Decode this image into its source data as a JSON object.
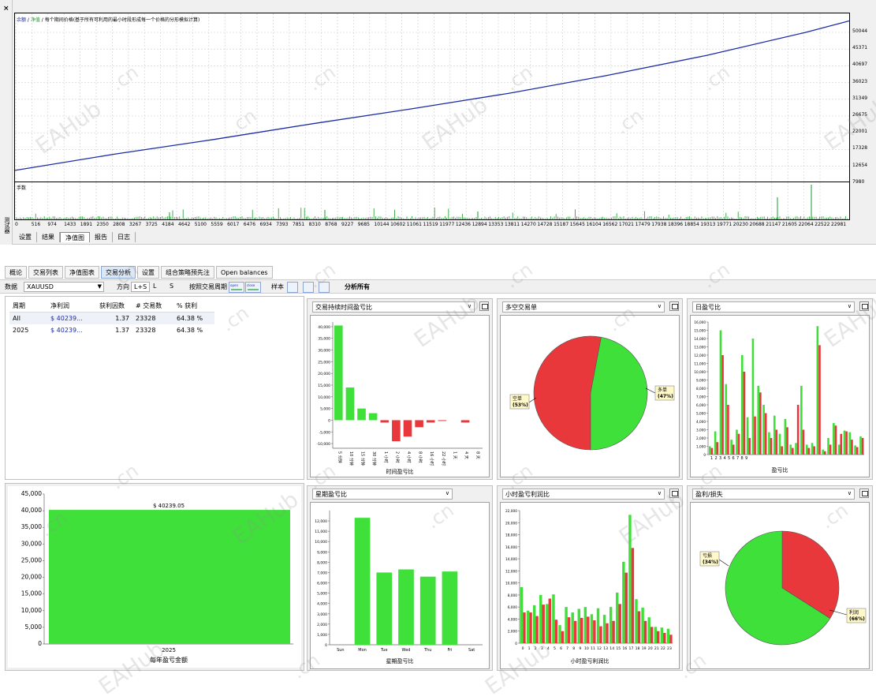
{
  "tester": {
    "close_label": "×",
    "side_label": "测试器",
    "graph_title_part1": "余额",
    "graph_title_sep1": " / ",
    "graph_title_part2": "净值",
    "graph_title_rest": " / 每个期间价格(基于所有可利用的最小时段形成每一个价格的分形模拟计算)",
    "vol_title": "手数",
    "y_ticks": [
      "50044",
      "45371",
      "40697",
      "36023",
      "31349",
      "26675",
      "22001",
      "17328",
      "12654",
      "7980"
    ],
    "x_ticks": [
      "0",
      "516",
      "974",
      "1433",
      "1891",
      "2350",
      "2808",
      "3267",
      "3725",
      "4184",
      "4642",
      "5100",
      "5559",
      "6017",
      "6476",
      "6934",
      "7393",
      "7851",
      "8310",
      "8768",
      "9227",
      "9685",
      "10144",
      "10602",
      "11061",
      "11519",
      "11977",
      "12436",
      "12894",
      "13353",
      "13811",
      "14270",
      "14728",
      "15187",
      "15645",
      "16104",
      "16562",
      "17021",
      "17479",
      "17938",
      "18396",
      "18854",
      "19313",
      "19771",
      "20230",
      "20688",
      "21147",
      "21605",
      "22064",
      "22522",
      "22981"
    ],
    "tabs": [
      "设置",
      "结果",
      "净值图",
      "报告",
      "日志"
    ],
    "active_tab": "净值图",
    "balance_color": "#1b2ca6",
    "equity_color": "#1b9a2a"
  },
  "analysis": {
    "tabs": [
      "概论",
      "交易列表",
      "净值图表",
      "交易分析",
      "设置",
      "组合策略预先注",
      "Open balances"
    ],
    "active_tab": "交易分析",
    "toolbar": {
      "data_label": "数据",
      "symbol": "XAUUSD",
      "direction_label": "方向",
      "dir_all": "L+S",
      "dir_long": "L",
      "dir_short": "S",
      "period_label": "按照交易周期",
      "open_time": "open time",
      "close_time": "close time",
      "sample_label": "样本",
      "analyze_all": "分析所有"
    },
    "stats_table": {
      "headers": [
        "周期",
        "净利润",
        "获利因数",
        "# 交易数",
        "% 获利"
      ],
      "rows": [
        [
          "All",
          "$ 40239...",
          "1.37",
          "23328",
          "64.38 %"
        ],
        [
          "2025",
          "$ 40239...",
          "1.37",
          "23328",
          "64.38 %"
        ]
      ]
    },
    "panels": {
      "hold_time": {
        "select": "交易持续时间盈亏比",
        "xlabel": "时间盈亏比"
      },
      "long_short": {
        "select": "多空交易单",
        "short_label": "空单",
        "short_pct": "(53%)",
        "long_label": "多单",
        "long_pct": "(47%)"
      },
      "daily": {
        "select": "日盈亏比",
        "xlabel": "盈亏比"
      },
      "yearly": {
        "xlabel": "每年盈亏金额",
        "value_label": "$ 40239.05"
      },
      "weekday": {
        "select": "星期盈亏比",
        "xlabel": "星期盈亏比"
      },
      "hourly": {
        "select": "小时盈亏利润比",
        "xlabel": "小时盈亏利润比"
      },
      "profit_loss": {
        "select": "盈利/损失",
        "loss_label": "亏损",
        "loss_pct": "(34%)",
        "profit_label": "利润",
        "profit_pct": "(66%)"
      }
    }
  },
  "watermark": {
    "text": "EAHub",
    "suffix": ".cn"
  },
  "chart_data": [
    {
      "type": "line",
      "title": "余额 / 净值",
      "ylim": [
        7980,
        52000
      ],
      "series": [
        {
          "name": "余额",
          "x": [
            0,
            2808,
            5559,
            8310,
            11061,
            13811,
            16562,
            19313,
            22064,
            23300
          ],
          "y": [
            10900,
            15200,
            19000,
            23100,
            27000,
            31100,
            35800,
            41000,
            47000,
            50044
          ]
        }
      ]
    },
    {
      "type": "bar",
      "categories": [
        "5 分钟",
        "10 分钟",
        "15 分钟",
        "30 分钟",
        "1 小时",
        "2 小时",
        "4 小时",
        "8 小时",
        "16 小时",
        "22 小时",
        "1 天",
        "4 天",
        "8 天"
      ],
      "values": [
        40500,
        14000,
        5000,
        3000,
        -1000,
        -9000,
        -7000,
        -3000,
        -1000,
        -200,
        0,
        -1000,
        0
      ],
      "ylim": [
        -12000,
        42000
      ],
      "yticks": [
        -10000,
        -5000,
        0,
        5000,
        10000,
        15000,
        20000,
        25000,
        30000,
        35000,
        40000
      ],
      "xlabel": "时间盈亏比"
    },
    {
      "type": "pie",
      "labels": [
        "空单",
        "多单"
      ],
      "values": [
        53,
        47
      ],
      "colors": [
        "#e8383b",
        "#3fe03a"
      ]
    },
    {
      "type": "bar",
      "xlabel": "盈亏比",
      "ylim": [
        0,
        16000
      ],
      "yticks": [
        0,
        1000,
        2000,
        3000,
        4000,
        5000,
        6000,
        7000,
        8000,
        9000,
        10000,
        11000,
        12000,
        13000,
        14000,
        15000,
        16000
      ],
      "categories": [
        "1",
        "2",
        "3",
        "4",
        "5",
        "6",
        "7",
        "8",
        "9"
      ],
      "series": [
        {
          "name": "green",
          "values": [
            1000,
            2800,
            15000,
            8500,
            1800,
            3000,
            12000,
            4500,
            14000,
            8300,
            6000,
            2700,
            4700,
            2500,
            4300,
            1200,
            1400,
            8300,
            1200,
            1400,
            15500,
            600,
            2000,
            3800,
            1200,
            2900,
            2700,
            1100,
            2200
          ]
        },
        {
          "name": "red",
          "values": [
            800,
            1500,
            12000,
            6000,
            1200,
            2500,
            10000,
            2000,
            4600,
            7500,
            5000,
            2000,
            3000,
            1000,
            3300,
            800,
            6000,
            3000,
            800,
            1000,
            13200,
            400,
            1200,
            3500,
            2500,
            2800,
            1800,
            900,
            2000
          ]
        }
      ]
    },
    {
      "type": "bar",
      "categories": [
        "2025"
      ],
      "values": [
        40239.05
      ],
      "ylim": [
        0,
        45000
      ],
      "yticks": [
        0,
        5000,
        10000,
        15000,
        20000,
        25000,
        30000,
        35000,
        40000,
        45000
      ],
      "xlabel": "每年盈亏金额"
    },
    {
      "type": "bar",
      "categories": [
        "Sun",
        "Mon",
        "Tue",
        "Wed",
        "Thu",
        "Fri",
        "Sat"
      ],
      "values": [
        0,
        12300,
        7000,
        7300,
        6600,
        7100,
        0
      ],
      "ylim": [
        0,
        13000
      ],
      "yticks": [
        0,
        1000,
        2000,
        3000,
        4000,
        5000,
        6000,
        7000,
        8000,
        9000,
        10000,
        11000,
        12000
      ],
      "xlabel": "星期盈亏比"
    },
    {
      "type": "bar",
      "categories": [
        "0",
        "1",
        "2",
        "3",
        "4",
        "5",
        "6",
        "7",
        "8",
        "9",
        "10",
        "11",
        "12",
        "13",
        "14",
        "15",
        "16",
        "17",
        "18",
        "19",
        "20",
        "21",
        "22",
        "23"
      ],
      "series": [
        {
          "name": "green",
          "values": [
            9300,
            5400,
            6300,
            8000,
            6500,
            8100,
            3000,
            6000,
            5100,
            5700,
            6000,
            4800,
            5800,
            4700,
            6000,
            8400,
            13500,
            21300,
            7300,
            5900,
            4300,
            2700,
            2600,
            2400
          ]
        },
        {
          "name": "red",
          "values": [
            5100,
            5100,
            4500,
            6400,
            7400,
            3900,
            2000,
            4300,
            3700,
            4200,
            4400,
            3800,
            2800,
            3300,
            3700,
            6500,
            11700,
            15800,
            5300,
            3700,
            2700,
            2000,
            1700,
            1400
          ]
        }
      ],
      "ylim": [
        0,
        22000
      ],
      "yticks": [
        0,
        2000,
        4000,
        6000,
        8000,
        10000,
        12000,
        14000,
        16000,
        18000,
        20000,
        22000
      ],
      "xlabel": "小时盈亏利润比"
    },
    {
      "type": "pie",
      "labels": [
        "亏损",
        "利润"
      ],
      "values": [
        34,
        66
      ],
      "colors": [
        "#e8383b",
        "#3fe03a"
      ]
    }
  ]
}
